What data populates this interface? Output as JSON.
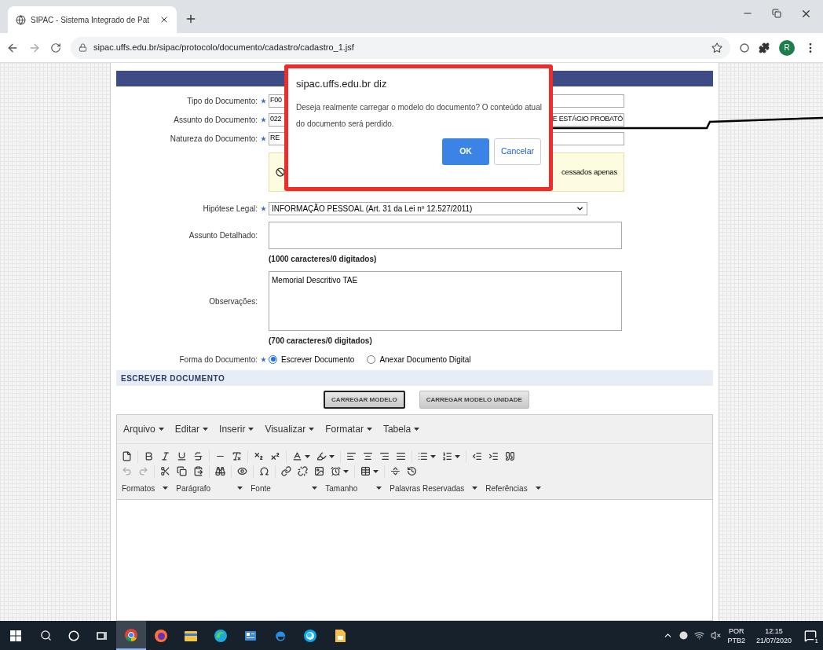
{
  "browser": {
    "tabs": [
      {
        "title": "SIPAC - Sistema Integrado de Pat",
        "selected": true
      }
    ],
    "url": "sipac.uffs.edu.br/sipac/protocolo/documento/cadastro/cadastro_1.jsf",
    "avatar": "R"
  },
  "form": {
    "fields": [
      {
        "kind": "input",
        "label": "Tipo do Documento:",
        "required": true,
        "value": "F00"
      },
      {
        "kind": "input",
        "label": "Assunto do Documento:",
        "required": true,
        "value": "022",
        "value_end": "E ESTÁGIO PROBATÓ"
      },
      {
        "kind": "input",
        "label": "Natureza do Documento:",
        "required": true,
        "value": "RE"
      },
      {
        "kind": "notice",
        "text": "cessados apenas"
      },
      {
        "kind": "select",
        "label": "Hipótese Legal:",
        "required": true,
        "value": "INFORMAÇÃO PESSOAL (Art. 31 da Lei nº 12.527/2011)"
      },
      {
        "kind": "textarea",
        "label": "Assunto Detalhado:",
        "required": false,
        "counter": "(1000 caracteres/0 digitados)"
      },
      {
        "kind": "textarea",
        "label": "Observações:",
        "required": false,
        "value": "Memorial Descritivo TAE",
        "counter": "(700 caracteres/0 digitados)"
      },
      {
        "kind": "radio",
        "label": "Forma do Documento:",
        "required": true,
        "options": [
          {
            "label": "Escrever Documento",
            "selected": true
          },
          {
            "label": "Anexar Documento Digital",
            "selected": false
          }
        ]
      }
    ]
  },
  "section_title": "ESCREVER DOCUMENTO",
  "template_buttons": [
    {
      "label": "CARREGAR MODELO",
      "focused": true
    },
    {
      "label": "CARREGAR MODELO UNIDADE",
      "focused": false
    }
  ],
  "editor": {
    "menus": [
      "Arquivo",
      "Editar",
      "Inserir",
      "Visualizar",
      "Formatar",
      "Tabela"
    ],
    "dropdowns": [
      "Formatos",
      "Parágrafo",
      "Fonte",
      "Tamanho",
      "Palavras Reservadas",
      "Referências"
    ]
  },
  "dialog": {
    "title": "sipac.uffs.edu.br diz",
    "message": "Deseja realmente carregar o modelo do documento? O conteúdo atual do documento será perdido.",
    "buttons": [
      {
        "label": "OK",
        "primary": true
      },
      {
        "label": "Cancelar",
        "primary": false
      }
    ]
  },
  "taskbar": {
    "language": "POR",
    "layout": "PTB2",
    "time": "12:15",
    "date": "21/07/2020",
    "notifications": "1"
  }
}
